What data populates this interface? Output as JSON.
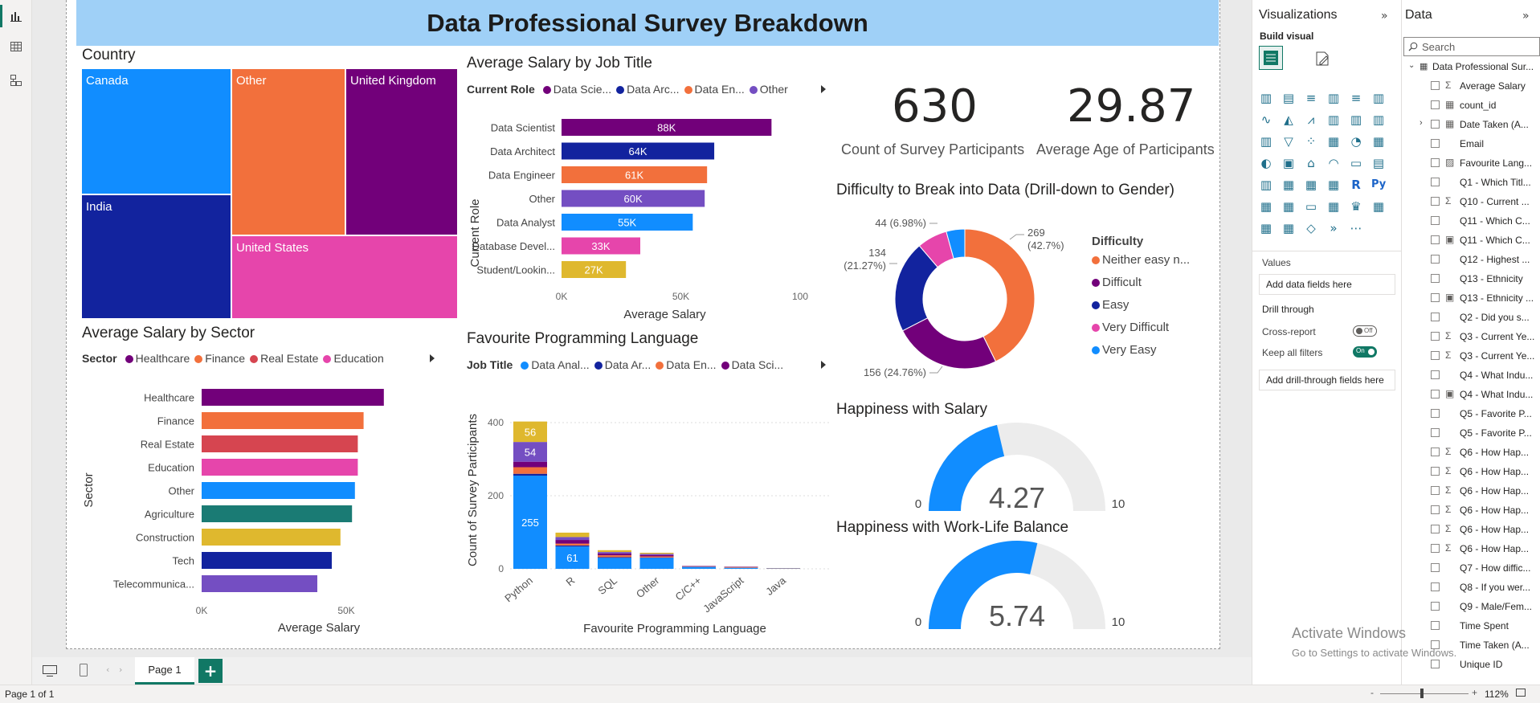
{
  "report_title": "Data Professional Survey Breakdown",
  "colors": {
    "purple": "#72007a",
    "orange": "#f2703c",
    "blue": "#118dff",
    "navy": "#12239e",
    "pink": "#e645ab",
    "teal": "#1a7b74",
    "gold": "#dfb82e",
    "violet": "#744ec2",
    "red": "#d64550"
  },
  "country": {
    "title": "Country",
    "tiles": [
      {
        "label": "Canada",
        "color": "#118dff"
      },
      {
        "label": "India",
        "color": "#12239e"
      },
      {
        "label": "Other",
        "color": "#f2703c"
      },
      {
        "label": "United Kingdom",
        "color": "#72007a"
      },
      {
        "label": "United States",
        "color": "#e645ab"
      }
    ]
  },
  "salary_by_job": {
    "title": "Average Salary by Job Title",
    "legend_title": "Current Role",
    "legend_items": [
      {
        "label": "Data Scie...",
        "color": "#72007a"
      },
      {
        "label": "Data Arc...",
        "color": "#12239e"
      },
      {
        "label": "Data En...",
        "color": "#f2703c"
      },
      {
        "label": "Other",
        "color": "#744ec2"
      }
    ],
    "ylabel": "Current Role",
    "xlabel": "Average Salary",
    "ticks": [
      "0K",
      "50K",
      "100"
    ]
  },
  "salary_by_sector": {
    "title": "Average Salary by Sector",
    "legend_title": "Sector",
    "legend_items": [
      {
        "label": "Healthcare",
        "color": "#72007a"
      },
      {
        "label": "Finance",
        "color": "#f2703c"
      },
      {
        "label": "Real Estate",
        "color": "#d64550"
      },
      {
        "label": "Education",
        "color": "#e645ab"
      }
    ],
    "ylabel": "Sector",
    "xlabel": "Average Salary",
    "ticks": [
      "0K",
      "50K"
    ]
  },
  "fav_lang": {
    "title": "Favourite Programming Language",
    "legend_title": "Job Title",
    "legend_items": [
      {
        "label": "Data Anal...",
        "color": "#118dff"
      },
      {
        "label": "Data Ar...",
        "color": "#12239e"
      },
      {
        "label": "Data En...",
        "color": "#f2703c"
      },
      {
        "label": "Data Sci...",
        "color": "#72007a"
      }
    ],
    "ylabel": "Count of Survey Participants",
    "xlabel": "Favourite Programming Language",
    "ticks": [
      "0",
      "200",
      "400"
    ]
  },
  "kpi": [
    {
      "value": "630",
      "label": "Count of Survey Participants"
    },
    {
      "value": "29.87",
      "label": "Average Age of Participants"
    }
  ],
  "difficulty": {
    "title": "Difficulty to Break into Data (Drill-down to Gender)",
    "legend_title": "Difficulty",
    "legend_items": [
      {
        "label": "Neither easy n...",
        "color": "#f2703c"
      },
      {
        "label": "Difficult",
        "color": "#72007a"
      },
      {
        "label": "Easy",
        "color": "#12239e"
      },
      {
        "label": "Very Difficult",
        "color": "#e645ab"
      },
      {
        "label": "Very Easy",
        "color": "#118dff"
      }
    ],
    "labels": {
      "neither_a": "269",
      "neither_b": "(42.7%)",
      "easy_a": "134",
      "easy_b": "(21.27%)",
      "very_difficult": "44 (6.98%)",
      "difficult": "156 (24.76%)"
    }
  },
  "gauge_salary": {
    "title": "Happiness with Salary",
    "value": "4.27",
    "min": "0",
    "max": "10"
  },
  "gauge_wlb": {
    "title": "Happiness with Work-Life Balance",
    "value": "5.74",
    "min": "0",
    "max": "10"
  },
  "chart_data": [
    {
      "type": "bar",
      "orientation": "horizontal",
      "title": "Average Salary by Job Title",
      "categories": [
        "Data Scientist",
        "Data Architect",
        "Data Engineer",
        "Other",
        "Data Analyst",
        "Database Devel...",
        "Student/Lookin..."
      ],
      "values": [
        88,
        64,
        61,
        60,
        55,
        33,
        27
      ],
      "data_labels": [
        "88K",
        "64K",
        "61K",
        "60K",
        "55K",
        "33K",
        "27K"
      ],
      "colors": [
        "#72007a",
        "#12239e",
        "#f2703c",
        "#744ec2",
        "#118dff",
        "#e645ab",
        "#dfb82e"
      ],
      "xlabel": "Average Salary",
      "ylabel": "Current Role",
      "xlim": [
        0,
        100
      ]
    },
    {
      "type": "bar",
      "orientation": "horizontal",
      "title": "Average Salary by Sector",
      "categories": [
        "Healthcare",
        "Finance",
        "Real Estate",
        "Education",
        "Other",
        "Agriculture",
        "Construction",
        "Tech",
        "Telecommunica..."
      ],
      "values": [
        63,
        56,
        54,
        54,
        53,
        52,
        48,
        45,
        40
      ],
      "colors": [
        "#72007a",
        "#f2703c",
        "#d64550",
        "#e645ab",
        "#118dff",
        "#1a7b74",
        "#dfb82e",
        "#12239e",
        "#744ec2"
      ],
      "xlabel": "Average Salary",
      "ylabel": "Sector",
      "xlim": [
        0,
        75
      ]
    },
    {
      "type": "bar",
      "stacked": true,
      "title": "Favourite Programming Language",
      "categories": [
        "Python",
        "R",
        "SQL",
        "Other",
        "C/C++",
        "JavaScript",
        "Java"
      ],
      "series": [
        {
          "name": "Data Anal...",
          "color": "#118dff",
          "values": [
            255,
            61,
            30,
            30,
            5,
            3,
            1
          ],
          "labels": [
            "255",
            "61",
            "",
            "",
            "",
            "",
            ""
          ]
        },
        {
          "name": "Data Ar...",
          "color": "#12239e",
          "values": [
            5,
            3,
            2,
            1,
            1,
            0,
            0
          ],
          "labels": [
            "",
            "",
            "",
            "",
            "",
            "",
            ""
          ]
        },
        {
          "name": "Data En...",
          "color": "#f2703c",
          "values": [
            18,
            5,
            5,
            3,
            1,
            2,
            1
          ],
          "labels": [
            "",
            "",
            "",
            "",
            "",
            "",
            ""
          ]
        },
        {
          "name": "Data Sci...",
          "color": "#72007a",
          "values": [
            15,
            10,
            5,
            4,
            1,
            1,
            0
          ],
          "labels": [
            "",
            "",
            "",
            "",
            "",
            "",
            ""
          ]
        },
        {
          "name": "",
          "color": "#744ec2",
          "values": [
            54,
            8,
            4,
            3,
            0,
            0,
            0
          ],
          "labels": [
            "54",
            "",
            "",
            "",
            "",
            "",
            ""
          ]
        },
        {
          "name": "",
          "color": "#dfb82e",
          "values": [
            56,
            12,
            5,
            3,
            0,
            0,
            0
          ],
          "labels": [
            "56",
            "",
            "",
            "",
            "",
            "",
            ""
          ]
        }
      ],
      "xlabel": "Favourite Programming Language",
      "ylabel": "Count of Survey Participants",
      "ylim": [
        0,
        430
      ]
    },
    {
      "type": "pie",
      "donut": true,
      "title": "Difficulty to Break into Data (Drill-down to Gender)",
      "categories": [
        "Neither easy n...",
        "Difficult",
        "Easy",
        "Very Difficult",
        "Very Easy"
      ],
      "values": [
        269,
        156,
        134,
        44,
        27
      ],
      "colors": [
        "#f2703c",
        "#72007a",
        "#12239e",
        "#e645ab",
        "#118dff"
      ]
    },
    {
      "type": "gauge",
      "title": "Happiness with Salary",
      "value": 4.27,
      "min": 0,
      "max": 10
    },
    {
      "type": "gauge",
      "title": "Happiness with Work-Life Balance",
      "value": 5.74,
      "min": 0,
      "max": 10
    }
  ],
  "viz_pane": {
    "title": "Visualizations",
    "build_visual": "Build visual",
    "values_label": "Values",
    "add_data_fields": "Add data fields here",
    "drill_through": "Drill through",
    "cross_report": "Cross-report",
    "cross_report_state": "Off",
    "keep_filters": "Keep all filters",
    "keep_filters_state": "On",
    "add_drill": "Add drill-through fields here"
  },
  "data_pane": {
    "title": "Data",
    "search_placeholder": "Search",
    "table_name": "Data Professional Sur...",
    "fields": [
      {
        "icon": "Σ",
        "label": "Average Salary"
      },
      {
        "icon": "▦",
        "label": "count_id"
      },
      {
        "icon": "▦",
        "label": "Date Taken (A..."
      },
      {
        "icon": "",
        "label": "Email"
      },
      {
        "icon": "▨",
        "label": "Favourite Lang..."
      },
      {
        "icon": "",
        "label": "Q1 - Which Titl..."
      },
      {
        "icon": "Σ",
        "label": "Q10 - Current ..."
      },
      {
        "icon": "",
        "label": "Q11 - Which C..."
      },
      {
        "icon": "▣",
        "label": "Q11 - Which C..."
      },
      {
        "icon": "",
        "label": "Q12 - Highest ..."
      },
      {
        "icon": "",
        "label": "Q13 - Ethnicity"
      },
      {
        "icon": "▣",
        "label": "Q13 - Ethnicity ..."
      },
      {
        "icon": "",
        "label": "Q2 - Did you s..."
      },
      {
        "icon": "Σ",
        "label": "Q3 - Current Ye..."
      },
      {
        "icon": "Σ",
        "label": "Q3 - Current Ye..."
      },
      {
        "icon": "",
        "label": "Q4 - What Indu..."
      },
      {
        "icon": "▣",
        "label": "Q4 - What Indu..."
      },
      {
        "icon": "",
        "label": "Q5 - Favorite P..."
      },
      {
        "icon": "",
        "label": "Q5 - Favorite P..."
      },
      {
        "icon": "Σ",
        "label": "Q6 - How Hap..."
      },
      {
        "icon": "Σ",
        "label": "Q6 - How Hap..."
      },
      {
        "icon": "Σ",
        "label": "Q6 - How Hap..."
      },
      {
        "icon": "Σ",
        "label": "Q6 - How Hap..."
      },
      {
        "icon": "Σ",
        "label": "Q6 - How Hap..."
      },
      {
        "icon": "Σ",
        "label": "Q6 - How Hap..."
      },
      {
        "icon": "",
        "label": "Q7 - How diffic..."
      },
      {
        "icon": "",
        "label": "Q8 - If you wer..."
      },
      {
        "icon": "",
        "label": "Q9 - Male/Fem..."
      },
      {
        "icon": "",
        "label": "Time Spent"
      },
      {
        "icon": "",
        "label": "Time Taken (A..."
      },
      {
        "icon": "",
        "label": "Unique ID"
      }
    ]
  },
  "tabs": {
    "page1": "Page 1",
    "add": "+"
  },
  "status": {
    "page": "Page 1 of 1",
    "zoom": "112%"
  },
  "watermark": {
    "title": "Activate Windows",
    "sub": "Go to Settings to activate Windows."
  }
}
